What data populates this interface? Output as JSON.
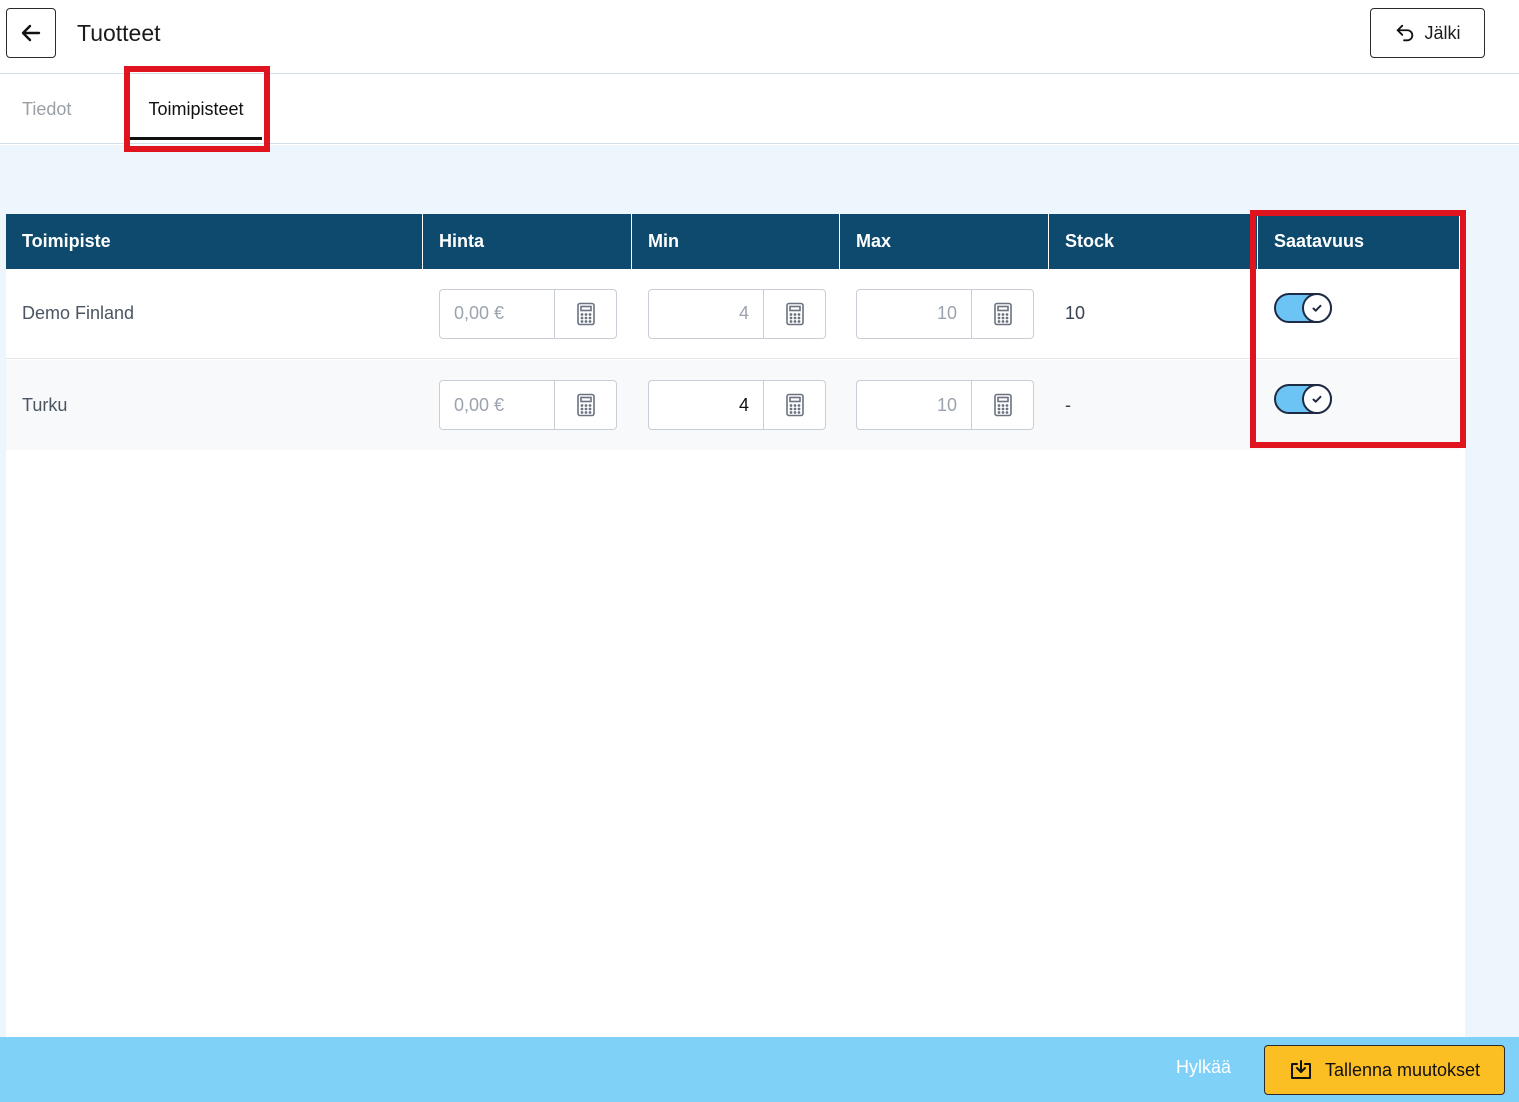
{
  "header": {
    "title": "Tuotteet",
    "undo_label": "Jälki"
  },
  "tabs": [
    {
      "label": "Tiedot",
      "active": false
    },
    {
      "label": "Toimipisteet",
      "active": true
    }
  ],
  "table": {
    "columns": [
      "Toimipiste",
      "Hinta",
      "Min",
      "Max",
      "Stock",
      "Saatavuus"
    ],
    "rows": [
      {
        "name": "Demo Finland",
        "price": "0,00 €",
        "min": "4",
        "max": "10",
        "stock": "10",
        "available": true
      },
      {
        "name": "Turku",
        "price": "0,00 €",
        "min": "4",
        "max": "10",
        "stock": "-",
        "available": true
      }
    ]
  },
  "footer": {
    "discard_label": "Hylkää",
    "save_label": "Tallenna muutokset"
  },
  "colors": {
    "header_bg": "#0e4a6e",
    "footer_bg": "#7fd1f8",
    "save_button": "#fbbf24",
    "toggle_on": "#6cc4f5",
    "highlight": "#e0141e"
  }
}
